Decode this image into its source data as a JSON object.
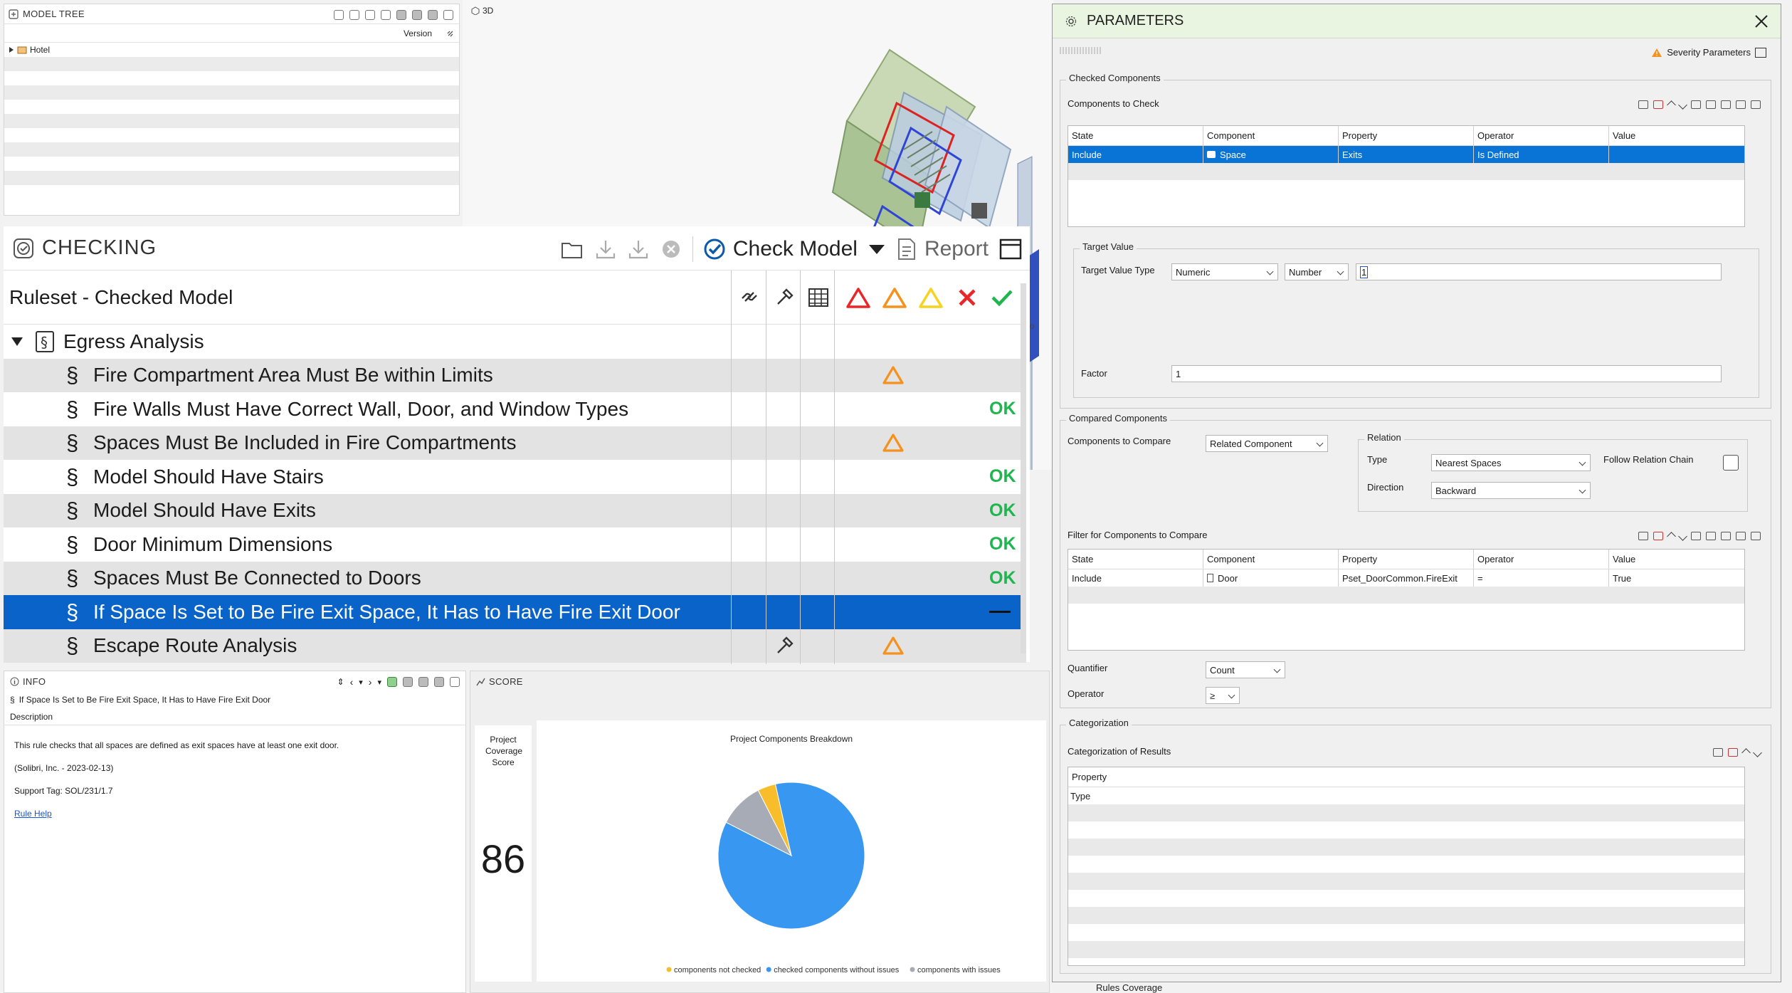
{
  "model_tree": {
    "title": "MODEL TREE",
    "column_version": "Version",
    "root_item": "Hotel"
  },
  "view3d": {
    "title": "3D"
  },
  "checking": {
    "title": "CHECKING",
    "check_model_label": "Check Model",
    "report_label": "Report",
    "tree_header": "Ruleset - Checked Model",
    "ruleset_name": "Egress Analysis",
    "rules": [
      {
        "label": "Fire Compartment Area Must Be within Limits",
        "result": "warning"
      },
      {
        "label": "Fire Walls Must Have Correct Wall, Door, and Window Types",
        "result": "OK"
      },
      {
        "label": "Spaces Must Be Included in Fire Compartments",
        "result": "warning"
      },
      {
        "label": "Model Should Have Stairs",
        "result": "OK"
      },
      {
        "label": "Model Should Have Exits",
        "result": "OK"
      },
      {
        "label": "Door Minimum Dimensions",
        "result": "OK"
      },
      {
        "label": "Spaces Must Be Connected to Doors",
        "result": "OK"
      },
      {
        "label": "If Space Is Set to Be Fire Exit Space, It Has to Have Fire Exit Door",
        "result": "—"
      },
      {
        "label": "Escape Route Analysis",
        "result": "warning"
      }
    ],
    "ok_text": "OK"
  },
  "info": {
    "title": "INFO",
    "rule_name": "If Space Is Set to Be Fire Exit Space, It Has to Have Fire Exit Door",
    "description_label": "Description",
    "description": "This rule checks that all spaces are defined as exit spaces have at least one exit door.",
    "author": "(Solibri, Inc. - 2023-02-13)",
    "support_tag": "Support Tag: SOL/231/1.7",
    "help_link": "Rule Help"
  },
  "score": {
    "title": "SCORE",
    "coverage_label": "Project Coverage Score",
    "coverage_value": "86"
  },
  "chart_data": {
    "type": "pie",
    "title": "Project Components Breakdown",
    "labels": [
      "components not checked",
      "checked components without issues",
      "components with issues"
    ],
    "values": [
      4,
      86,
      10
    ],
    "colors": [
      "#f7bd2a",
      "#3897f0",
      "#a7abb5"
    ],
    "legend_position": "bottom"
  },
  "params": {
    "title": "PARAMETERS",
    "severity_label": "Severity Parameters",
    "checked_components": {
      "group": "Checked Components",
      "subheading": "Components to Check",
      "columns": [
        "State",
        "Component",
        "Property",
        "Operator",
        "Value"
      ],
      "rows": [
        [
          "Include",
          "Space",
          "Exits",
          "Is Defined",
          ""
        ]
      ]
    },
    "target_value": {
      "group": "Target Value",
      "type_label": "Target Value Type",
      "type_value": "Numeric",
      "unit_value": "Number",
      "value": "1",
      "factor_label": "Factor",
      "factor_value": "1"
    },
    "compared_components": {
      "group": "Compared Components",
      "compare_label": "Components to Compare",
      "compare_value": "Related Component",
      "relation_group": "Relation",
      "type_label": "Type",
      "type_value": "Nearest Spaces",
      "follow_label": "Follow Relation Chain",
      "direction_label": "Direction",
      "direction_value": "Backward",
      "filter_heading": "Filter for Components to Compare",
      "columns": [
        "State",
        "Component",
        "Property",
        "Operator",
        "Value"
      ],
      "rows": [
        [
          "Include",
          "Door",
          "Pset_DoorCommon.FireExit",
          "=",
          "True"
        ]
      ],
      "quantifier_label": "Quantifier",
      "quantifier_value": "Count",
      "operator_label": "Operator",
      "operator_value": "≥"
    },
    "categorization": {
      "group": "Categorization",
      "subheading": "Categorization of Results",
      "column": "Property",
      "rows": [
        "Type"
      ]
    },
    "rules_coverage": "Rules Coverage"
  }
}
